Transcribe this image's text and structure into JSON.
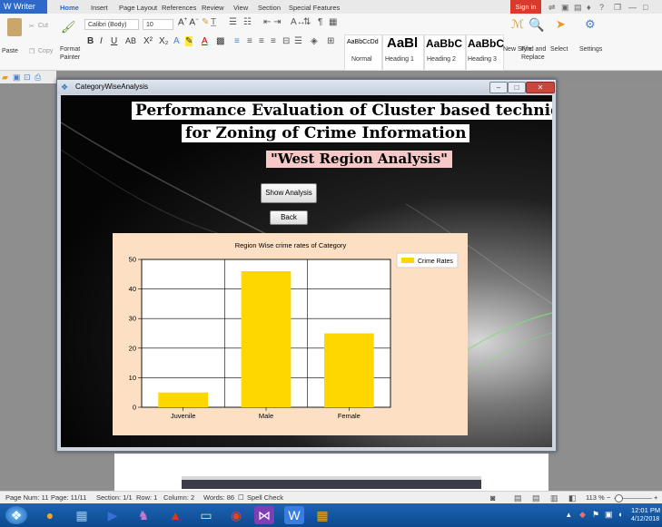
{
  "writer": {
    "app_button": "W Writer",
    "tabs": [
      "Home",
      "Insert",
      "Page Layout",
      "References",
      "Review",
      "View",
      "Section",
      "Special Features"
    ],
    "sign_in": "Sign in",
    "ribbon": {
      "paste": "Paste",
      "cut": "Cut",
      "copy": "Copy",
      "format_painter_1": "Format",
      "format_painter_2": "Painter",
      "font_name": "Calibri (Body)",
      "font_size": "10",
      "styles": [
        {
          "preview": "AaBbCcDd",
          "name": "Normal"
        },
        {
          "preview": "AaBl",
          "name": "Heading 1"
        },
        {
          "preview": "AaBbC",
          "name": "Heading 2"
        },
        {
          "preview": "AaBbC",
          "name": "Heading 3"
        }
      ],
      "new_style": "New Style",
      "find_replace_1": "Find and",
      "find_replace_2": "Replace",
      "select": "Select",
      "settings": "Settings"
    }
  },
  "app": {
    "window_title": "CategoryWiseAnalysis",
    "heading_line1": "Performance Evaluation of Cluster based technique",
    "heading_line2": "for Zoning of Crime Information",
    "region_label": "\"West Region Analysis\"",
    "show_analysis_button": "Show Analysis",
    "back_button": "Back"
  },
  "chart_data": {
    "type": "bar",
    "title": "Region Wise crime rates of Category",
    "categories": [
      "Juvenile",
      "Male",
      "Female"
    ],
    "series": [
      {
        "name": "Crime Rates",
        "values": [
          5,
          46,
          25
        ],
        "color": "#ffd700"
      }
    ],
    "ylim": [
      0,
      50
    ],
    "yticks": [
      0,
      10,
      20,
      30,
      40,
      50
    ],
    "legend_position": "top-right",
    "grid": true
  },
  "statusbar": {
    "page_num": "Page Num: 11",
    "page": "Page: 11/11",
    "section": "Section: 1/1",
    "row": "Row: 1",
    "column": "Column: 2",
    "words": "Words: 86",
    "spell_check": "Spell Check",
    "zoom": "113 %"
  },
  "clock": {
    "time": "12:01 PM",
    "date": "4/12/2018"
  }
}
